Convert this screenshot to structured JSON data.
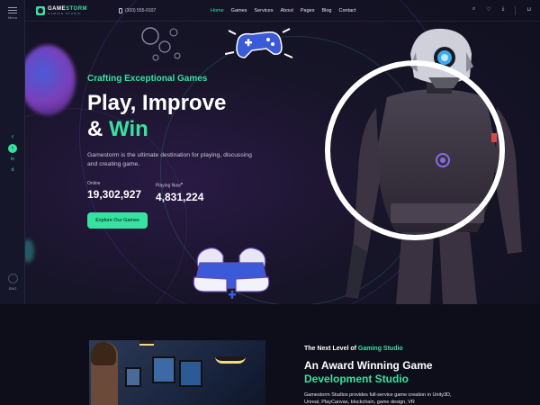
{
  "brand": {
    "name_a": "GAME",
    "name_b": "STORM",
    "tagline": "GAMING STUDIO"
  },
  "header": {
    "phone": "(303) 555-0107",
    "nav": [
      "Home",
      "Games",
      "Services",
      "About",
      "Pages",
      "Blog",
      "Contact"
    ],
    "active_nav": "Home"
  },
  "rail": {
    "menu_label": "Menu",
    "social": [
      "f",
      "t",
      "in",
      "d"
    ],
    "bottom_label": "ENG"
  },
  "hero": {
    "kicker": "Crafting Exceptional Games",
    "title_line1": "Play, Improve",
    "title_amp": "&",
    "title_accent": "Win",
    "description": "Gamestorm is the ultimate destination for playing, discussing and creating game.",
    "stats": [
      {
        "label": "Online",
        "value": "19,302,927"
      },
      {
        "label": "Playing Now",
        "value": "4,831,224"
      }
    ],
    "cta": "Explore Our Games"
  },
  "about": {
    "kicker_plain": "The Next Level of",
    "kicker_accent": "Gaming Studio",
    "title_line1": "An Award Winning Game",
    "title_accent": "Development Studio",
    "description": "Gamestorm Studios provides full-service game creation in Unity3D, Unreal, PlayCanvas, blockchain, game design, VR"
  },
  "colors": {
    "accent": "#36e2a0",
    "background": "#0d0e1a",
    "ring": "#ffffff"
  }
}
